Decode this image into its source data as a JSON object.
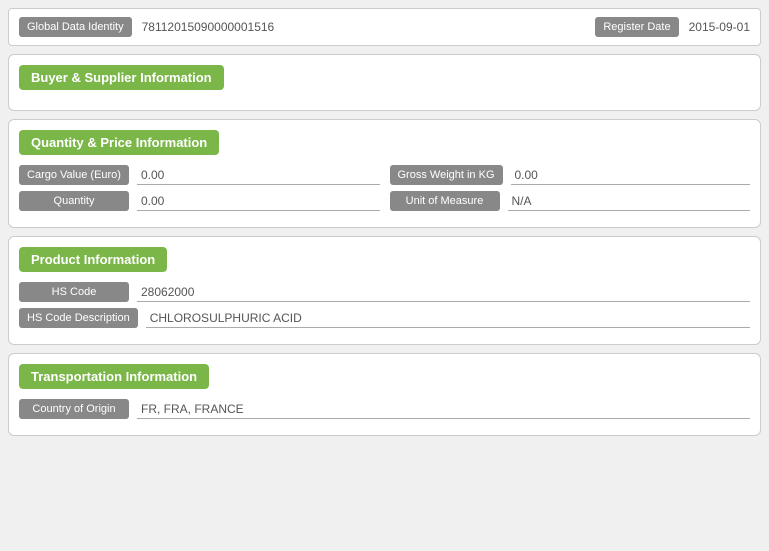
{
  "header": {
    "gdi_label": "Global Data Identity",
    "gdi_value": "78112015090000001516",
    "register_label": "Register Date",
    "register_value": "2015-09-01"
  },
  "sections": {
    "buyer_supplier": {
      "title": "Buyer & Supplier Information"
    },
    "quantity_price": {
      "title": "Quantity & Price Information",
      "fields": {
        "cargo_value_label": "Cargo Value (Euro)",
        "cargo_value": "0.00",
        "gross_weight_label": "Gross Weight in KG",
        "gross_weight": "0.00",
        "quantity_label": "Quantity",
        "quantity": "0.00",
        "unit_measure_label": "Unit of Measure",
        "unit_measure": "N/A"
      }
    },
    "product": {
      "title": "Product Information",
      "fields": {
        "hs_code_label": "HS Code",
        "hs_code": "28062000",
        "hs_desc_label": "HS Code Description",
        "hs_desc": "CHLOROSULPHURIC ACID"
      }
    },
    "transportation": {
      "title": "Transportation Information",
      "fields": {
        "country_origin_label": "Country of Origin",
        "country_origin": "FR, FRA, FRANCE"
      }
    }
  }
}
